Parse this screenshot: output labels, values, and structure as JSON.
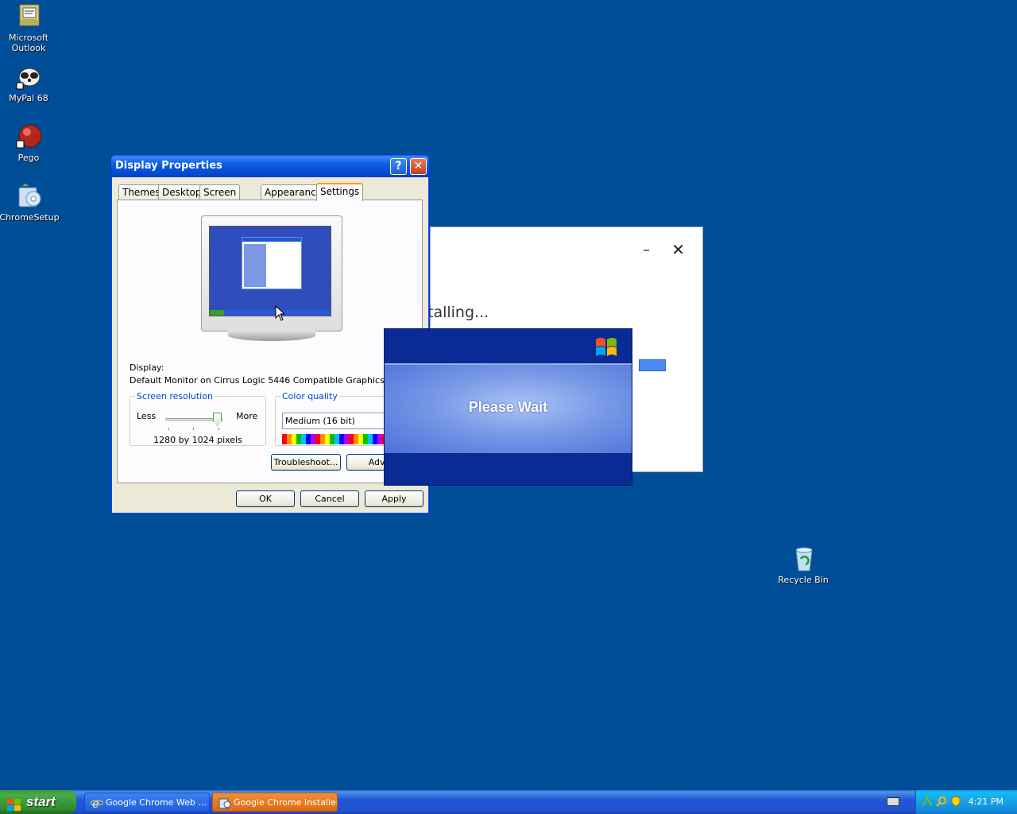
{
  "desktop": {
    "icons": [
      {
        "label_line1": "Microsoft",
        "label_line2": "Outlook",
        "icon": "outlook-icon"
      },
      {
        "label_line1": "MyPal 68",
        "label_line2": "",
        "icon": "mypal-icon"
      },
      {
        "label_line1": "Pego",
        "label_line2": "",
        "icon": "pego-icon"
      },
      {
        "label_line1": "ChromeSetup",
        "label_line2": "",
        "icon": "chromesetup-icon"
      },
      {
        "label_line1": "Recycle Bin",
        "label_line2": "",
        "icon": "recycle-bin-icon"
      }
    ]
  },
  "display_properties": {
    "title": "Display Properties",
    "help_glyph": "?",
    "close_glyph": "✕",
    "tabs": [
      "Themes",
      "Desktop",
      "Screen Saver",
      "Appearance",
      "Settings"
    ],
    "active_tab": "Settings",
    "display_label": "Display:",
    "display_adapter": "Default Monitor on Cirrus Logic 5446 Compatible Graphics Adapter",
    "resolution": {
      "legend": "Screen resolution",
      "less": "Less",
      "more": "More",
      "value": "1280 by 1024 pixels",
      "slider_level": 1.0
    },
    "color_quality": {
      "legend": "Color quality",
      "selected": "Medium (16 bit)"
    },
    "buttons": {
      "troubleshoot": "Troubleshoot...",
      "advanced": "Advan",
      "ok": "OK",
      "cancel": "Cancel",
      "apply": "Apply"
    }
  },
  "chrome_installer": {
    "status": "talling...",
    "minimize_glyph": "–",
    "close_glyph": "✕"
  },
  "please_wait": {
    "message": "Please Wait"
  },
  "taskbar": {
    "start_label": "start",
    "tasks": [
      {
        "label": "Google Chrome Web ...",
        "icon": "ie-icon"
      },
      {
        "label": "Google Chrome Installer",
        "icon": "installer-icon"
      }
    ],
    "clock": "4:21 PM"
  }
}
